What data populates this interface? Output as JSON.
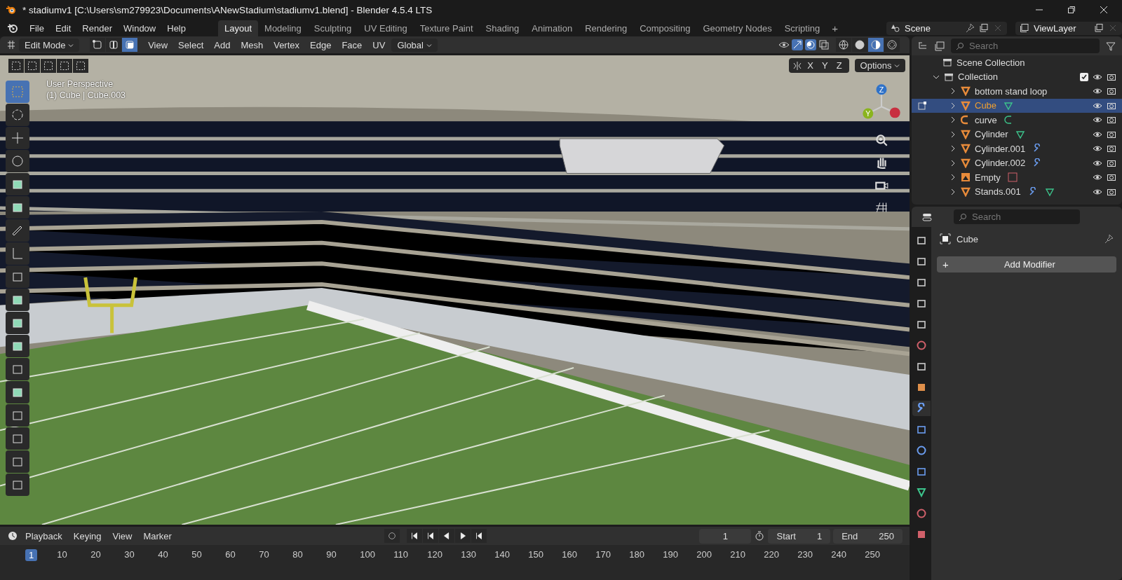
{
  "window": {
    "title": "* stadiumv1 [C:\\Users\\sm279923\\Documents\\ANewStadium\\stadiumv1.blend] - Blender 4.5.4 LTS"
  },
  "menu": [
    "File",
    "Edit",
    "Render",
    "Window",
    "Help"
  ],
  "workspaces": [
    {
      "label": "Layout",
      "selected": true
    },
    {
      "label": "Modeling",
      "selected": false
    },
    {
      "label": "Sculpting",
      "selected": false
    },
    {
      "label": "UV Editing",
      "selected": false
    },
    {
      "label": "Texture Paint",
      "selected": false
    },
    {
      "label": "Shading",
      "selected": false
    },
    {
      "label": "Animation",
      "selected": false
    },
    {
      "label": "Rendering",
      "selected": false
    },
    {
      "label": "Compositing",
      "selected": false
    },
    {
      "label": "Geometry Nodes",
      "selected": false
    },
    {
      "label": "Scripting",
      "selected": false
    }
  ],
  "add_workspace": "+",
  "scene": {
    "value": "Scene"
  },
  "view_layer": {
    "value": "ViewLayer"
  },
  "viewport_header": {
    "mode": "Edit Mode",
    "select_modes": [
      {
        "kind": "vertex",
        "selected": false
      },
      {
        "kind": "edge",
        "selected": false
      },
      {
        "kind": "face",
        "selected": true
      }
    ],
    "menus": [
      "View",
      "Select",
      "Add",
      "Mesh",
      "Vertex",
      "Edge",
      "Face",
      "UV"
    ],
    "orientation": "Global",
    "shading": [
      {
        "kind": "wireframe",
        "selected": false
      },
      {
        "kind": "solid",
        "selected": false
      },
      {
        "kind": "material",
        "selected": true
      },
      {
        "kind": "rendered",
        "selected": false
      }
    ]
  },
  "viewport": {
    "view_name": "User Perspective",
    "object_info": "(1) Cube | Cube.003",
    "axes": [
      "X",
      "Y",
      "Z"
    ],
    "options": "Options",
    "gizmo_axes": [
      "Z",
      "Y"
    ],
    "tools": [
      {
        "kind": "select",
        "selected": true
      },
      {
        "kind": "cursor",
        "selected": false
      },
      {
        "kind": "move",
        "selected": false
      },
      {
        "kind": "rotate",
        "selected": false
      },
      {
        "kind": "scale",
        "selected": false
      },
      {
        "kind": "transform",
        "selected": false
      },
      {
        "kind": "annotate",
        "selected": false
      },
      {
        "kind": "measure",
        "selected": false
      },
      {
        "kind": "add-cube",
        "selected": false
      },
      {
        "kind": "extrude",
        "selected": false
      },
      {
        "kind": "inset",
        "selected": false
      },
      {
        "kind": "bevel",
        "selected": false
      },
      {
        "kind": "loop-cut",
        "selected": false
      },
      {
        "kind": "knife",
        "selected": false
      },
      {
        "kind": "poly-build",
        "selected": false
      },
      {
        "kind": "spin",
        "selected": false
      },
      {
        "kind": "smooth",
        "selected": false
      },
      {
        "kind": "shrink",
        "selected": false
      }
    ]
  },
  "outliner": {
    "search": {
      "placeholder": "Search"
    },
    "root": "Scene Collection",
    "collection": {
      "name": "Collection",
      "checked": true,
      "expanded": true
    },
    "items": [
      {
        "name": "bottom stand loop",
        "kind": "mesh",
        "selected": false,
        "expanded": false
      },
      {
        "name": "Cube",
        "kind": "mesh",
        "selected": true,
        "expanded": false,
        "badges": [
          {
            "kind": "mesh-data"
          }
        ]
      },
      {
        "name": "curve",
        "kind": "curve",
        "selected": false,
        "expanded": false,
        "badges": [
          {
            "kind": "curve-data"
          }
        ]
      },
      {
        "name": "Cylinder",
        "kind": "mesh",
        "selected": false,
        "expanded": false,
        "badges": [
          {
            "kind": "mesh-data"
          }
        ]
      },
      {
        "name": "Cylinder.001",
        "kind": "mesh",
        "selected": false,
        "expanded": false,
        "badges": [
          {
            "kind": "modifier"
          }
        ]
      },
      {
        "name": "Cylinder.002",
        "kind": "mesh",
        "selected": false,
        "expanded": false,
        "badges": [
          {
            "kind": "modifier"
          }
        ]
      },
      {
        "name": "Empty",
        "kind": "empty",
        "selected": false,
        "expanded": false,
        "badges": [
          {
            "kind": "image"
          }
        ]
      },
      {
        "name": "Stands.001",
        "kind": "mesh",
        "selected": false,
        "expanded": false,
        "badges": [
          {
            "kind": "modifier"
          },
          {
            "kind": "vertex-group"
          }
        ]
      }
    ]
  },
  "properties": {
    "search": {
      "placeholder": "Search"
    },
    "object": "Cube",
    "add_modifier": "Add Modifier",
    "add_icon": "+",
    "tabs": [
      {
        "kind": "tool",
        "selected": false
      },
      {
        "kind": "render",
        "selected": false
      },
      {
        "kind": "output",
        "selected": false
      },
      {
        "kind": "view-layer",
        "selected": false
      },
      {
        "kind": "scene",
        "selected": false
      },
      {
        "kind": "world",
        "selected": false
      },
      {
        "kind": "collection",
        "selected": false
      },
      {
        "kind": "object",
        "selected": false
      },
      {
        "kind": "modifier",
        "selected": true
      },
      {
        "kind": "particles",
        "selected": false
      },
      {
        "kind": "physics",
        "selected": false
      },
      {
        "kind": "constraints",
        "selected": false
      },
      {
        "kind": "data",
        "selected": false
      },
      {
        "kind": "material",
        "selected": false
      },
      {
        "kind": "texture",
        "selected": false
      }
    ]
  },
  "timeline": {
    "menus": [
      "Playback",
      "Keying",
      "View",
      "Marker"
    ],
    "current_frame": "1",
    "start_label": "Start",
    "start": "1",
    "end_label": "End",
    "end": "250",
    "ruler": [
      {
        "label": "1",
        "selected": true
      },
      {
        "label": "10",
        "selected": false
      },
      {
        "label": "20",
        "selected": false
      },
      {
        "label": "30",
        "selected": false
      },
      {
        "label": "40",
        "selected": false
      },
      {
        "label": "50",
        "selected": false
      },
      {
        "label": "60",
        "selected": false
      },
      {
        "label": "70",
        "selected": false
      },
      {
        "label": "80",
        "selected": false
      },
      {
        "label": "90",
        "selected": false
      },
      {
        "label": "100",
        "selected": false
      },
      {
        "label": "110",
        "selected": false
      },
      {
        "label": "120",
        "selected": false
      },
      {
        "label": "130",
        "selected": false
      },
      {
        "label": "140",
        "selected": false
      },
      {
        "label": "150",
        "selected": false
      },
      {
        "label": "160",
        "selected": false
      },
      {
        "label": "170",
        "selected": false
      },
      {
        "label": "180",
        "selected": false
      },
      {
        "label": "190",
        "selected": false
      },
      {
        "label": "200",
        "selected": false
      },
      {
        "label": "210",
        "selected": false
      },
      {
        "label": "220",
        "selected": false
      },
      {
        "label": "230",
        "selected": false
      },
      {
        "label": "240",
        "selected": false
      },
      {
        "label": "250",
        "selected": false
      }
    ]
  }
}
